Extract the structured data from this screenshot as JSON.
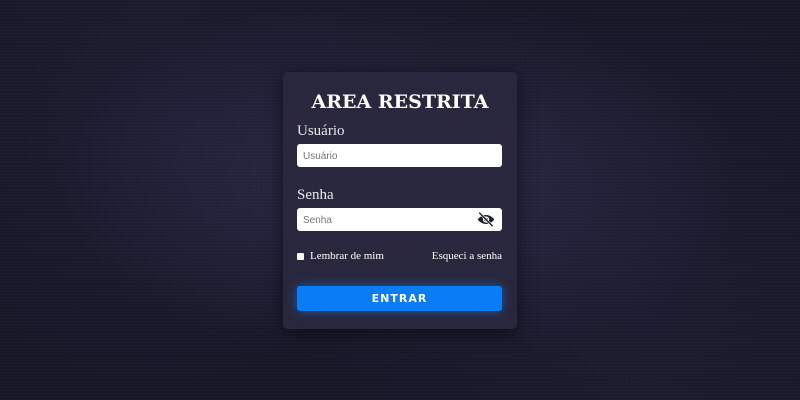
{
  "login": {
    "title": "AREA RESTRITA",
    "username_label": "Usuário",
    "username_placeholder": "Usuário",
    "password_label": "Senha",
    "password_placeholder": "Senha",
    "password_toggle_icon": "eye-slash-icon",
    "remember_label": "Lembrar de mim",
    "forgot_label": "Esqueci a senha",
    "submit_label": "ENTRAR"
  },
  "colors": {
    "background": "#181728",
    "card": "#2a283e",
    "button": "#0a7cf5",
    "text": "#ffffff"
  }
}
